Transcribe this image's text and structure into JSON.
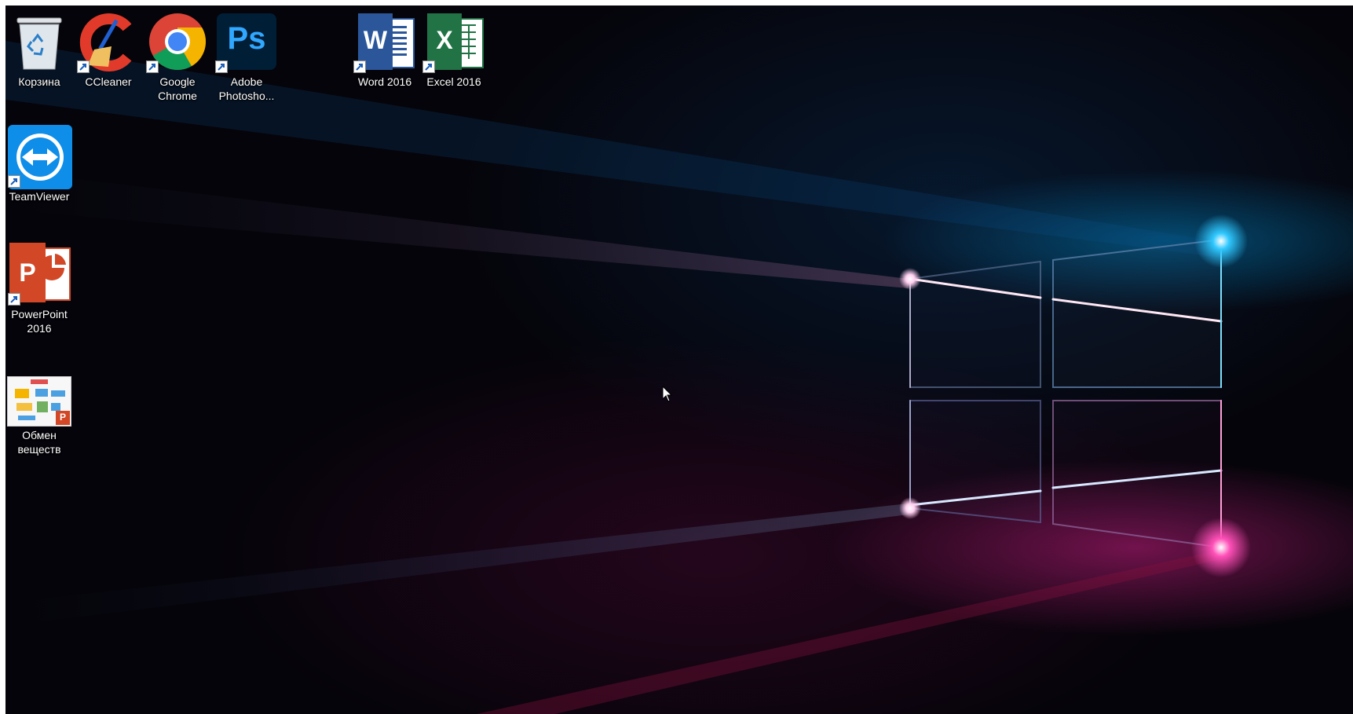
{
  "desktop": {
    "icons": [
      {
        "label": "Корзина",
        "icon": "recycle-bin-icon"
      },
      {
        "label": "CCleaner",
        "icon": "ccleaner-icon"
      },
      {
        "label": "Google Chrome",
        "icon": "chrome-icon"
      },
      {
        "label": "Adobe Photosho...",
        "icon": "photoshop-icon",
        "glyph": "Ps"
      },
      {
        "label": "Word 2016",
        "icon": "word-icon",
        "glyph": "W"
      },
      {
        "label": "Excel 2016",
        "icon": "excel-icon",
        "glyph": "X"
      },
      {
        "label": "TeamViewer",
        "icon": "teamviewer-icon"
      },
      {
        "label": "PowerPoint 2016",
        "icon": "powerpoint-icon",
        "glyph": "P"
      },
      {
        "label": "Обмен веществ",
        "icon": "presentation-file-icon"
      }
    ]
  },
  "colors": {
    "window_glow_blue": "#1fb4ff",
    "window_glow_pink": "#ff3fa8",
    "background": "#05040a"
  }
}
